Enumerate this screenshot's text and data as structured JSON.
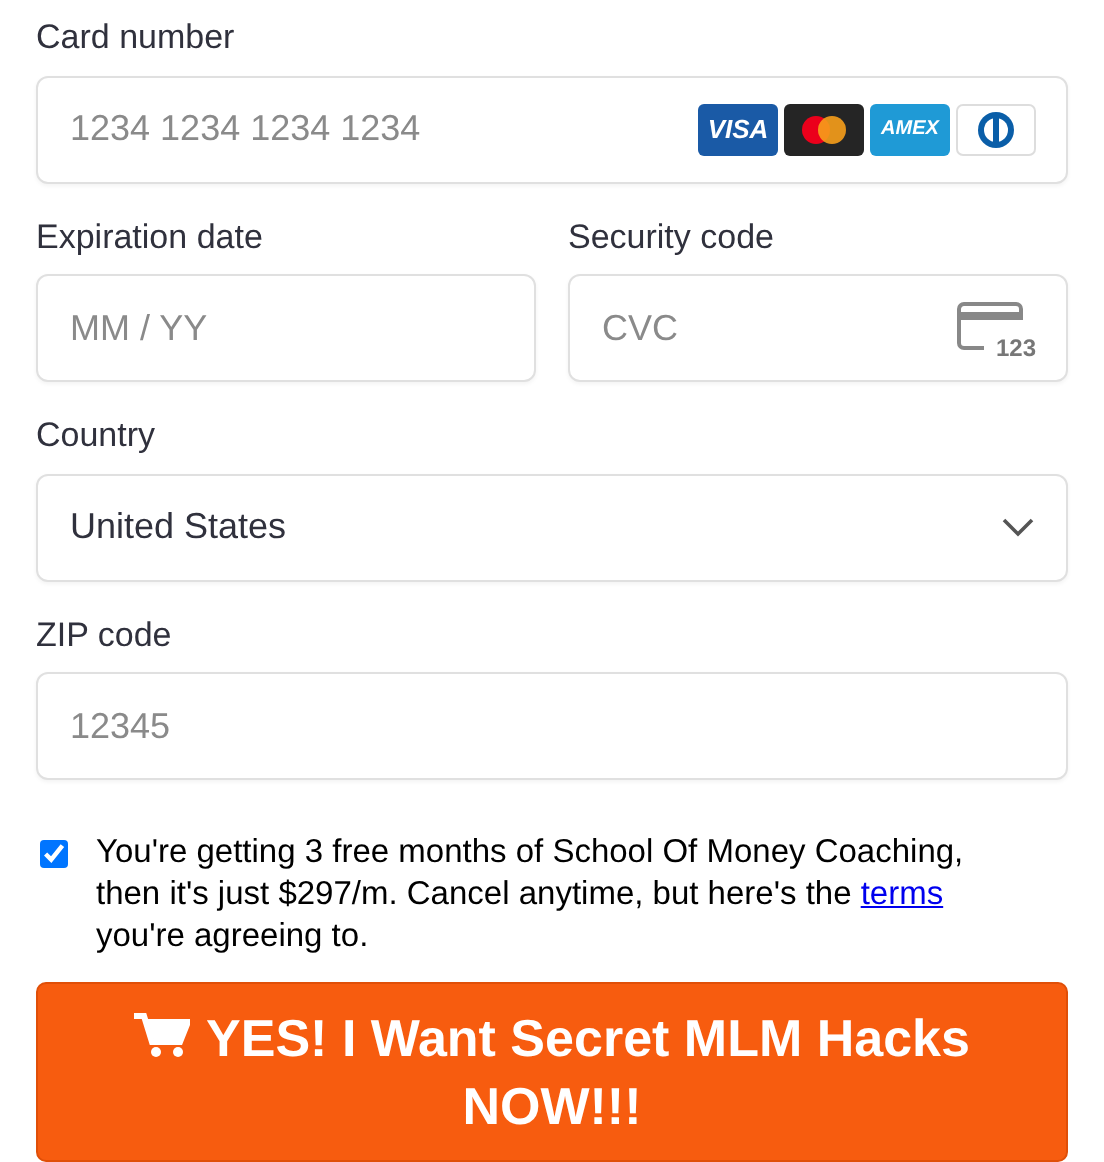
{
  "card_number": {
    "label": "Card number",
    "placeholder": "1234 1234 1234 1234",
    "brands": [
      {
        "kind": "visa",
        "text": "VISA"
      },
      {
        "kind": "mastercard"
      },
      {
        "kind": "amex",
        "text": "AMEX"
      },
      {
        "kind": "diners"
      }
    ]
  },
  "expiration": {
    "label": "Expiration date",
    "placeholder": "MM / YY"
  },
  "security_code": {
    "label": "Security code",
    "placeholder": "CVC",
    "icon_text": "123"
  },
  "country": {
    "label": "Country",
    "value": "United States"
  },
  "zip": {
    "label": "ZIP code",
    "placeholder": "12345"
  },
  "agreement": {
    "checked": true,
    "text_before": "You're getting 3 free months of School Of Money Coaching, then it's just $297/m. Cancel anytime, but here's the ",
    "link": "terms",
    "text_after": " you're agreeing to."
  },
  "submit": {
    "label": "YES! I Want Secret MLM Hacks NOW!!!"
  }
}
